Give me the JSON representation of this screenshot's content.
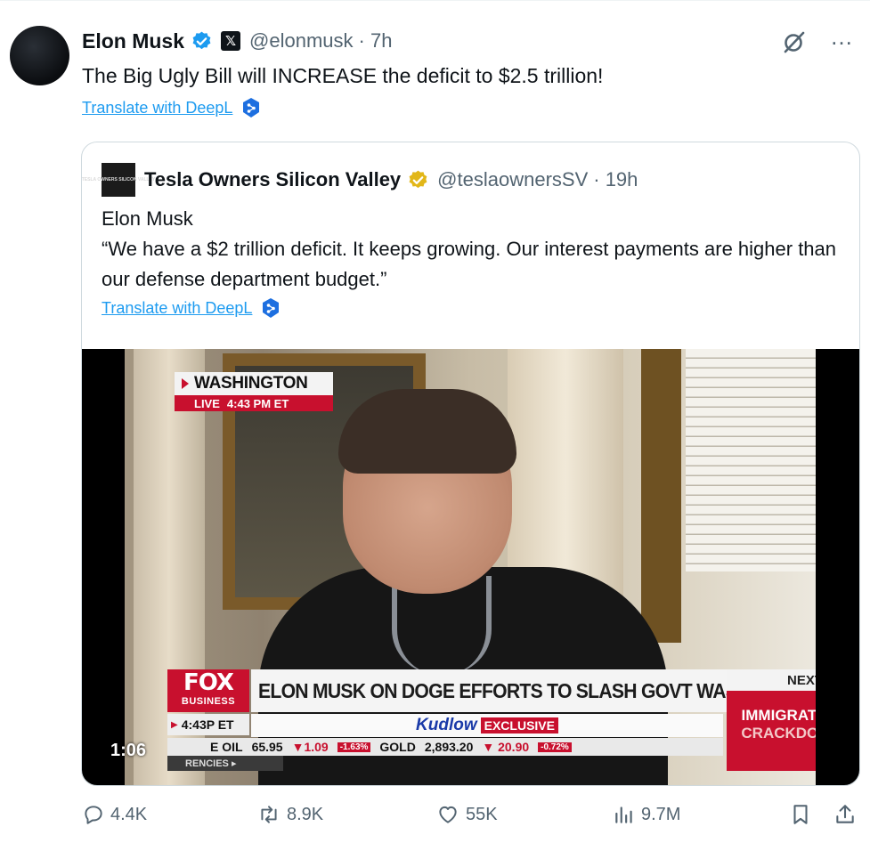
{
  "tweet": {
    "author_name": "Elon Musk",
    "handle": "@elonmusk",
    "time": "· 7h",
    "x_badge": "𝕏",
    "text": "The Big Ugly Bill will INCREASE the deficit to $2.5 trillion!",
    "translate_label": "Translate with DeepL"
  },
  "quote": {
    "avatar_text": "TESLA OWNERS SILICON VALLEY",
    "author_name": "Tesla Owners Silicon Valley",
    "handle": "@teslaownersSV",
    "time": "· 19h",
    "text_line1": "Elon Musk",
    "text_line2": "“We have a $2 trillion deficit. It keeps growing. Our interest payments are higher than our defense department budget.”",
    "translate_label": "Translate with DeepL"
  },
  "video": {
    "location": "WASHINGTON",
    "live_label": "LIVE",
    "live_time": "4:43 PM ET",
    "network": "FOX",
    "network_sub": "BUSINESS",
    "headline": "ELON MUSK ON DOGE EFFORTS TO SLASH GOVT WASTE",
    "show": "Kudlow",
    "show_tag": "EXCLUSIVE",
    "clock": "4:43P ET",
    "ticker_oil_label": "E OIL",
    "ticker_oil_value": "65.95",
    "ticker_oil_change": "▼1.09",
    "ticker_oil_pct": "-1.63%",
    "ticker_gold_label": "GOLD",
    "ticker_gold_value": "2,893.20",
    "ticker_gold_change": "▼ 20.90",
    "ticker_gold_pct": "-0.72%",
    "currencies": "RENCIES ▸",
    "next_label": "NEXT",
    "next_line1": "IMMIGRATION",
    "next_line2": "CRACKDOWN",
    "duration": "1:06"
  },
  "actions": {
    "replies": "4.4K",
    "reposts": "8.9K",
    "likes": "55K",
    "views": "9.7M"
  },
  "colors": {
    "accent": "#1d9bf0",
    "secondary_text": "#536471",
    "fox_red": "#c8102e"
  }
}
